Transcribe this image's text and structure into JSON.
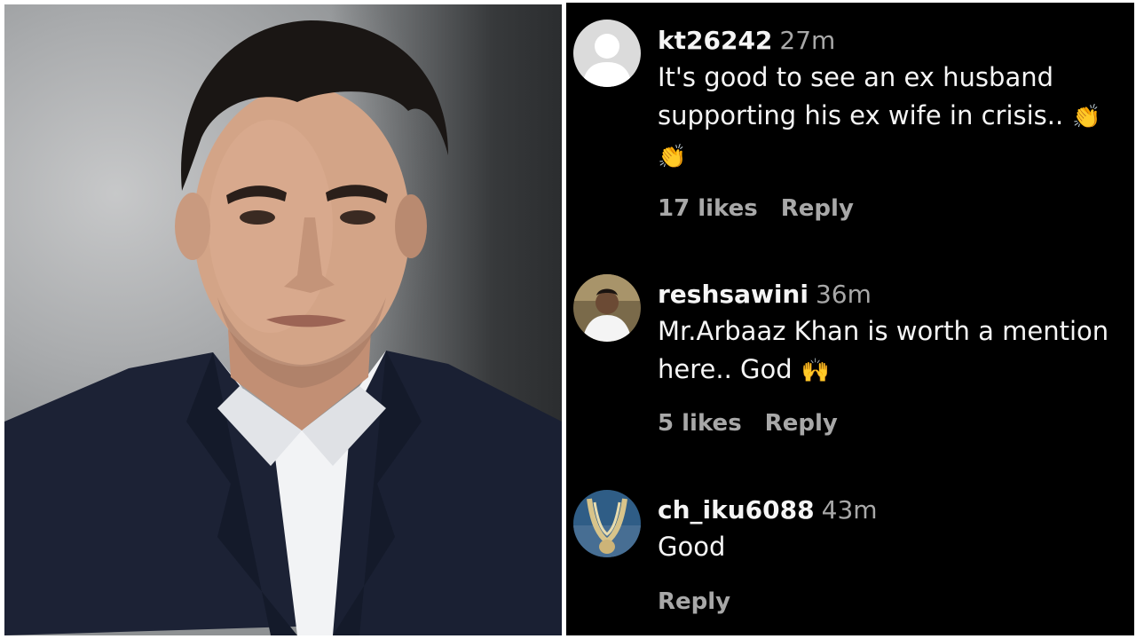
{
  "comments": [
    {
      "username": "kt26242",
      "time": "27m",
      "text": "It's good to see an ex husband supporting his ex wife in crisis..",
      "emoji_1": "👏",
      "emoji_2": "👏",
      "likes": "17 likes",
      "reply": "Reply"
    },
    {
      "username": "reshsawini",
      "time": "36m",
      "text": "Mr.Arbaaz Khan is worth a mention here.. God",
      "emoji_1": "🙌",
      "likes": "5 likes",
      "reply": "Reply"
    },
    {
      "username": "ch_iku6088",
      "time": "43m",
      "text": "Good",
      "reply": "Reply"
    }
  ],
  "colors": {
    "panel_bg": "#000000",
    "text_primary": "#f5f5f5",
    "text_secondary": "#a8a8a8",
    "default_avatar": "#dbdbdb"
  }
}
